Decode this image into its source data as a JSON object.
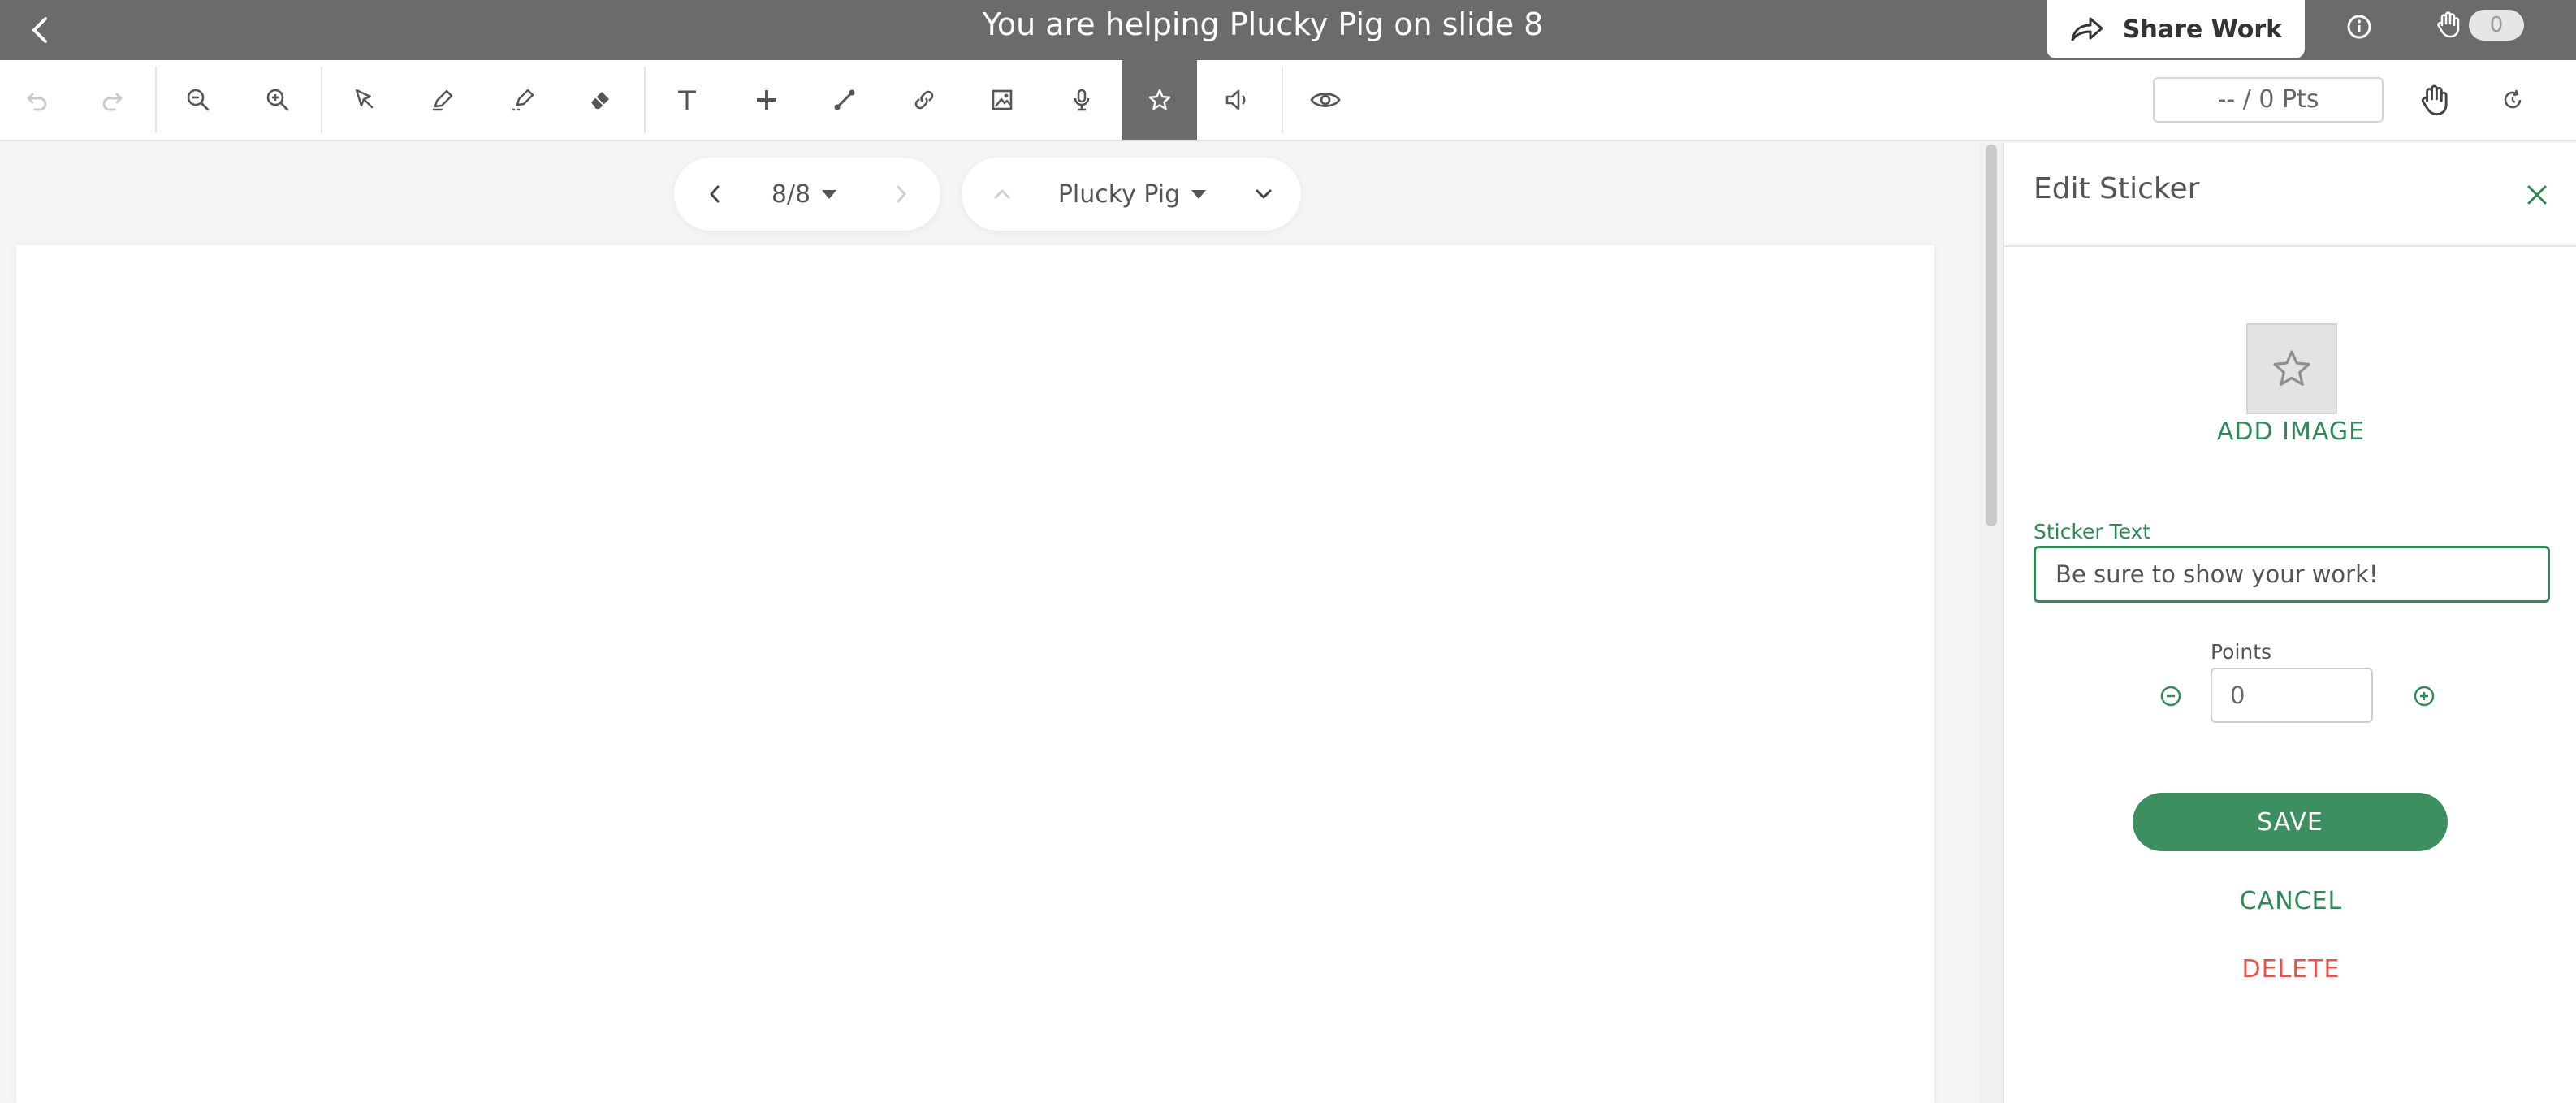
{
  "header": {
    "title": "You are helping Plucky Pig on slide 8",
    "share_label": "Share Work",
    "raised_hands_count": "0"
  },
  "toolbar": {
    "tools": [
      "undo-icon",
      "redo-icon",
      "zoom-out-icon",
      "zoom-in-icon",
      "select-icon",
      "pen-icon",
      "highlighter-icon",
      "eraser-icon",
      "text-icon",
      "shape-icon",
      "line-icon",
      "link-icon",
      "image-icon",
      "microphone-icon",
      "sticker-star-icon",
      "speaker-icon",
      "eye-icon"
    ],
    "active_tool": "sticker-star-icon",
    "points_display": "-- / 0 Pts"
  },
  "slide_nav": {
    "slide_position": "8/8",
    "student_name": "Plucky Pig"
  },
  "panel": {
    "title": "Edit Sticker",
    "add_image_label": "ADD IMAGE",
    "sticker_text_label": "Sticker Text",
    "sticker_text_value": "Be sure to show your work!",
    "points_label": "Points",
    "points_value": "0",
    "save_label": "SAVE",
    "cancel_label": "CANCEL",
    "delete_label": "DELETE"
  },
  "colors": {
    "header_bg": "#6b6b6d",
    "accent_green": "#2f8a55",
    "save_green": "#3d8f5f",
    "delete_red": "#e5534b"
  }
}
